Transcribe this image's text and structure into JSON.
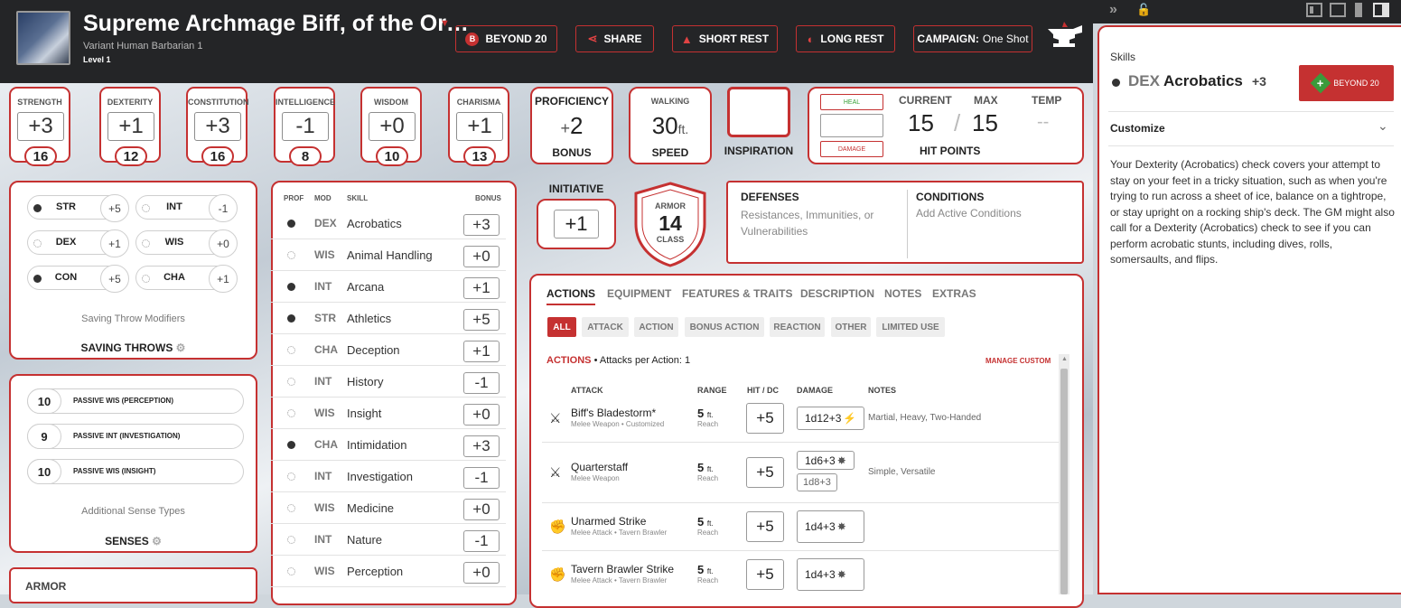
{
  "header": {
    "character_name": "Supreme Archmage Biff, of the Or…",
    "race_class": "Variant Human  Barbarian 1",
    "level": "Level 1",
    "buttons": {
      "beyond20": "BEYOND 20",
      "share": "SHARE",
      "short_rest": "SHORT REST",
      "long_rest": "LONG REST"
    },
    "campaign_label": "CAMPAIGN:",
    "campaign_value": "One Shot",
    "beyond20_badge": "B"
  },
  "abilities": [
    {
      "label": "STRENGTH",
      "modifier": "+3",
      "score": "16"
    },
    {
      "label": "DEXTERITY",
      "modifier": "+1",
      "score": "12"
    },
    {
      "label": "CONSTITUTION",
      "modifier": "+3",
      "score": "16"
    },
    {
      "label": "INTELLIGENCE",
      "modifier": "-1",
      "score": "8"
    },
    {
      "label": "WISDOM",
      "modifier": "+0",
      "score": "10"
    },
    {
      "label": "CHARISMA",
      "modifier": "+1",
      "score": "13"
    }
  ],
  "proficiency": {
    "top": "PROFICIENCY",
    "value": "2",
    "sign": "+",
    "bottom": "BONUS"
  },
  "speed": {
    "top": "WALKING",
    "value": "30",
    "unit": "ft.",
    "bottom": "SPEED"
  },
  "inspiration": {
    "label": "INSPIRATION"
  },
  "hit_points": {
    "heal": "HEAL",
    "damage": "DAMAGE",
    "current_label": "CURRENT",
    "max_label": "MAX",
    "temp_label": "TEMP",
    "current": "15",
    "max": "15",
    "temp": "--",
    "label": "HIT POINTS",
    "separator": "/"
  },
  "initiative": {
    "label": "INITIATIVE",
    "value": "+1"
  },
  "armor": {
    "top": "ARMOR",
    "value": "14",
    "bottom": "CLASS"
  },
  "defenses": {
    "title": "DEFENSES",
    "text": "Resistances, Immunities, or Vulnerabilities"
  },
  "conditions": {
    "title": "CONDITIONS",
    "text": "Add Active Conditions"
  },
  "saving_throws": {
    "items": [
      {
        "name": "STR",
        "value": "+5",
        "proficient": true
      },
      {
        "name": "INT",
        "value": "-1",
        "proficient": false
      },
      {
        "name": "DEX",
        "value": "+1",
        "proficient": false
      },
      {
        "name": "WIS",
        "value": "+0",
        "proficient": false
      },
      {
        "name": "CON",
        "value": "+5",
        "proficient": true
      },
      {
        "name": "CHA",
        "value": "+1",
        "proficient": false
      }
    ],
    "caption": "Saving Throw Modifiers",
    "title": "SAVING THROWS"
  },
  "senses": {
    "items": [
      {
        "value": "10",
        "label": "PASSIVE WIS (PERCEPTION)"
      },
      {
        "value": "9",
        "label": "PASSIVE INT (INVESTIGATION)"
      },
      {
        "value": "10",
        "label": "PASSIVE WIS (INSIGHT)"
      }
    ],
    "caption": "Additional Sense Types",
    "title": "SENSES"
  },
  "armor_section": {
    "title": "ARMOR"
  },
  "skills": {
    "headers": {
      "prof": "PROF",
      "mod": "MOD",
      "skill": "SKILL",
      "bonus": "BONUS"
    },
    "rows": [
      {
        "proficient": true,
        "mod": "DEX",
        "name": "Acrobatics",
        "bonus": "+3"
      },
      {
        "proficient": false,
        "mod": "WIS",
        "name": "Animal Handling",
        "bonus": "+0"
      },
      {
        "proficient": true,
        "mod": "INT",
        "name": "Arcana",
        "bonus": "+1"
      },
      {
        "proficient": true,
        "mod": "STR",
        "name": "Athletics",
        "bonus": "+5"
      },
      {
        "proficient": false,
        "mod": "CHA",
        "name": "Deception",
        "bonus": "+1"
      },
      {
        "proficient": false,
        "mod": "INT",
        "name": "History",
        "bonus": "-1"
      },
      {
        "proficient": false,
        "mod": "WIS",
        "name": "Insight",
        "bonus": "+0"
      },
      {
        "proficient": true,
        "mod": "CHA",
        "name": "Intimidation",
        "bonus": "+3"
      },
      {
        "proficient": false,
        "mod": "INT",
        "name": "Investigation",
        "bonus": "-1"
      },
      {
        "proficient": false,
        "mod": "WIS",
        "name": "Medicine",
        "bonus": "+0"
      },
      {
        "proficient": false,
        "mod": "INT",
        "name": "Nature",
        "bonus": "-1"
      },
      {
        "proficient": false,
        "mod": "WIS",
        "name": "Perception",
        "bonus": "+0"
      }
    ]
  },
  "main_tabs": [
    "ACTIONS",
    "EQUIPMENT",
    "FEATURES & TRAITS",
    "DESCRIPTION",
    "NOTES",
    "EXTRAS"
  ],
  "filter_tabs": [
    "ALL",
    "ATTACK",
    "ACTION",
    "BONUS ACTION",
    "REACTION",
    "OTHER",
    "LIMITED USE"
  ],
  "actions": {
    "title": "ACTIONS",
    "subtitle": "• Attacks per Action: 1",
    "manage": "MANAGE CUSTOM",
    "headers": {
      "attack": "ATTACK",
      "range": "RANGE",
      "hit": "HIT / DC",
      "damage": "DAMAGE",
      "notes": "NOTES"
    },
    "rows": [
      {
        "icon": "crossed-swords-icon",
        "name": "Biff's Bladestorm*",
        "sub": "Melee Weapon • Customized",
        "range": "5",
        "range_unit": "ft.",
        "range_sub": "Reach",
        "hit": "+5",
        "damage": [
          "1d12+3"
        ],
        "notes": "Martial, Heavy, Two-Handed"
      },
      {
        "icon": "crossed-swords-icon",
        "name": "Quarterstaff",
        "sub": "Melee Weapon",
        "range": "5",
        "range_unit": "ft.",
        "range_sub": "Reach",
        "hit": "+5",
        "damage": [
          "1d6+3",
          "1d8+3"
        ],
        "notes": "Simple, Versatile"
      },
      {
        "icon": "fist-icon",
        "name": "Unarmed Strike",
        "sub": "Melee Attack • Tavern Brawler",
        "range": "5",
        "range_unit": "ft.",
        "range_sub": "Reach",
        "hit": "+5",
        "damage": [
          "1d4+3"
        ],
        "notes": ""
      },
      {
        "icon": "fist-icon",
        "name": "Tavern Brawler Strike",
        "sub": "Melee Attack • Tavern Brawler",
        "range": "5",
        "range_unit": "ft.",
        "range_sub": "Reach",
        "hit": "+5",
        "damage": [
          "1d4+3"
        ],
        "notes": ""
      }
    ]
  },
  "sidebar": {
    "section": "Skills",
    "stat": "DEX",
    "skill": "Acrobatics",
    "bonus": "+3",
    "beyond20": "BEYOND 20",
    "customize": "Customize",
    "description": "Your Dexterity (Acrobatics) check covers your attempt to stay on your feet in a tricky situation, such as when you're trying to run across a sheet of ice, balance on a tightrope, or stay upright on a rocking ship's deck. The GM might also call for a Dexterity (Acrobatics) check to see if you can perform acrobatic stunts, including dives, rolls, somersaults, and flips."
  },
  "colors": {
    "accent": "#c53131",
    "header_bg": "#242527"
  }
}
